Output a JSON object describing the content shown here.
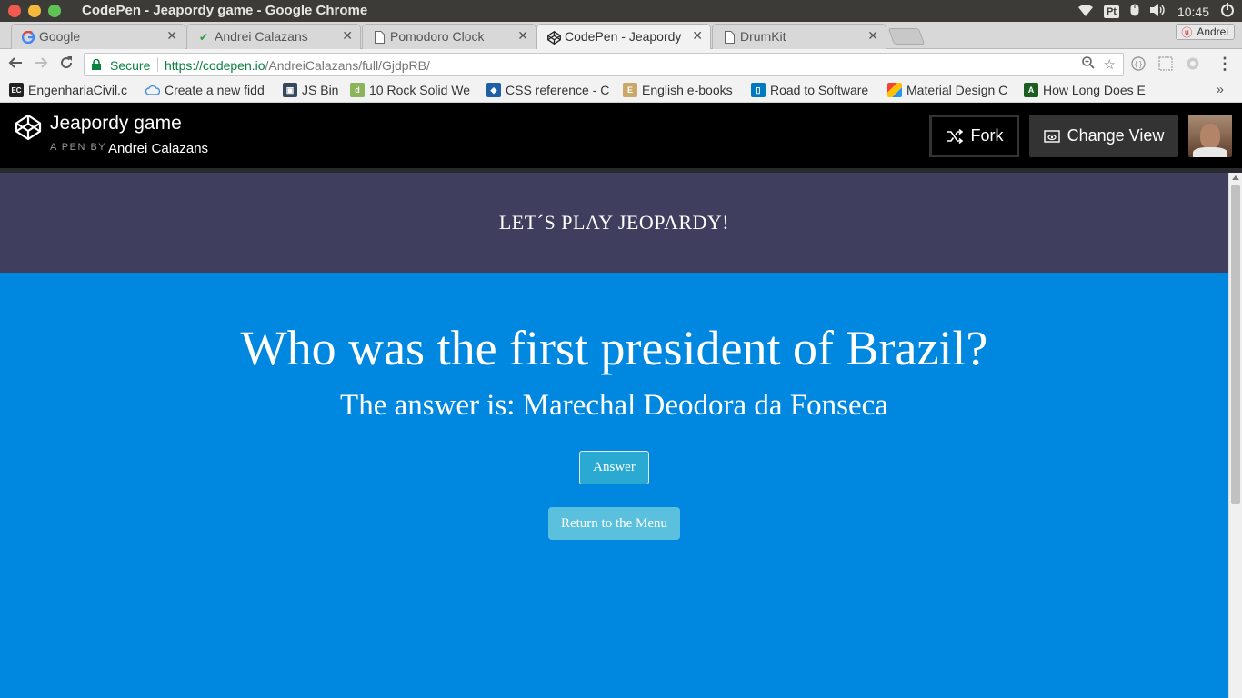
{
  "os": {
    "window_title": "CodePen - Jeapordy game - Google Chrome",
    "tray": {
      "lang": "Pt",
      "time": "10:45"
    },
    "colors": {
      "close": "#f05a4f",
      "minimize": "#f5b83e",
      "maximize": "#5fc455"
    }
  },
  "tabs": [
    {
      "label": "Google",
      "icon": "google-icon",
      "active": false
    },
    {
      "label": "Andrei Calazans",
      "icon": "check-shield-icon",
      "active": false
    },
    {
      "label": "Pomodoro Clock",
      "icon": "document-icon",
      "active": false
    },
    {
      "label": "CodePen - Jeapordy game",
      "icon": "codepen-icon",
      "active": true
    },
    {
      "label": "DrumKit",
      "icon": "document-icon",
      "active": false
    }
  ],
  "profile": {
    "name": "Andrei"
  },
  "address": {
    "secure_label": "Secure",
    "protocol": "https://",
    "host": "codepen.io",
    "path": "/AndreiCalazans/full/GjdpRB/"
  },
  "bookmarks": [
    {
      "label": "EngenhariaCivil.c",
      "icon": "ec-icon"
    },
    {
      "label": "Create a new fidd",
      "icon": "cloud-icon"
    },
    {
      "label": "JS Bin",
      "icon": "jsbin-icon"
    },
    {
      "label": "10 Rock Solid We",
      "icon": "d-icon"
    },
    {
      "label": "CSS reference - C",
      "icon": "css-icon"
    },
    {
      "label": "English e-books",
      "icon": "book-icon"
    },
    {
      "label": "Road to Software",
      "icon": "trello-icon"
    },
    {
      "label": "Material Design C",
      "icon": "material-icon"
    },
    {
      "label": "How Long Does E",
      "icon": "a-icon"
    }
  ],
  "codepen": {
    "pen_title": "Jeapordy game",
    "by_label": "A PEN BY",
    "author": "Andrei Calazans",
    "fork_label": "Fork",
    "change_view_label": "Change View"
  },
  "game": {
    "banner": "LET´S PLAY JEOPARDY!",
    "question": "Who was the first president of Brazil?",
    "answer": "The answer is: Marechal Deodora da Fonseca",
    "answer_button": "Answer",
    "menu_button": "Return to the Menu",
    "colors": {
      "banner_bg": "#3f3e5e",
      "main_bg": "#0088e0",
      "answer_btn": "#2aa9d2",
      "menu_btn": "#5bc0de"
    }
  }
}
